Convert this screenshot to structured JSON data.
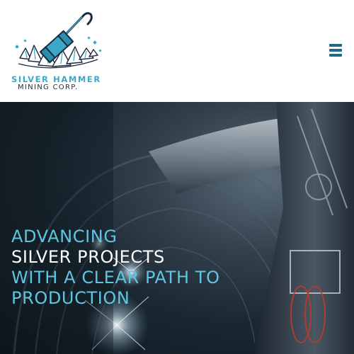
{
  "header": {
    "logo": {
      "icon": "silver-hammer-icon",
      "line1": "SILVER HAMMER",
      "line2": "MINING CORP."
    },
    "menu_icon": "hamburger-menu-icon"
  },
  "hero": {
    "background": "underground-mine-tunnel-image",
    "headline": [
      "ADVANCING",
      "SILVER PROJECTS",
      "WITH A CLEAR PATH TO",
      "PRODUCTION"
    ]
  },
  "colors": {
    "accent": "#5fc6e2",
    "logo_blue": "#3aa9c8",
    "logo_dark": "#1d2b3e",
    "menu": "#1f6a86"
  }
}
